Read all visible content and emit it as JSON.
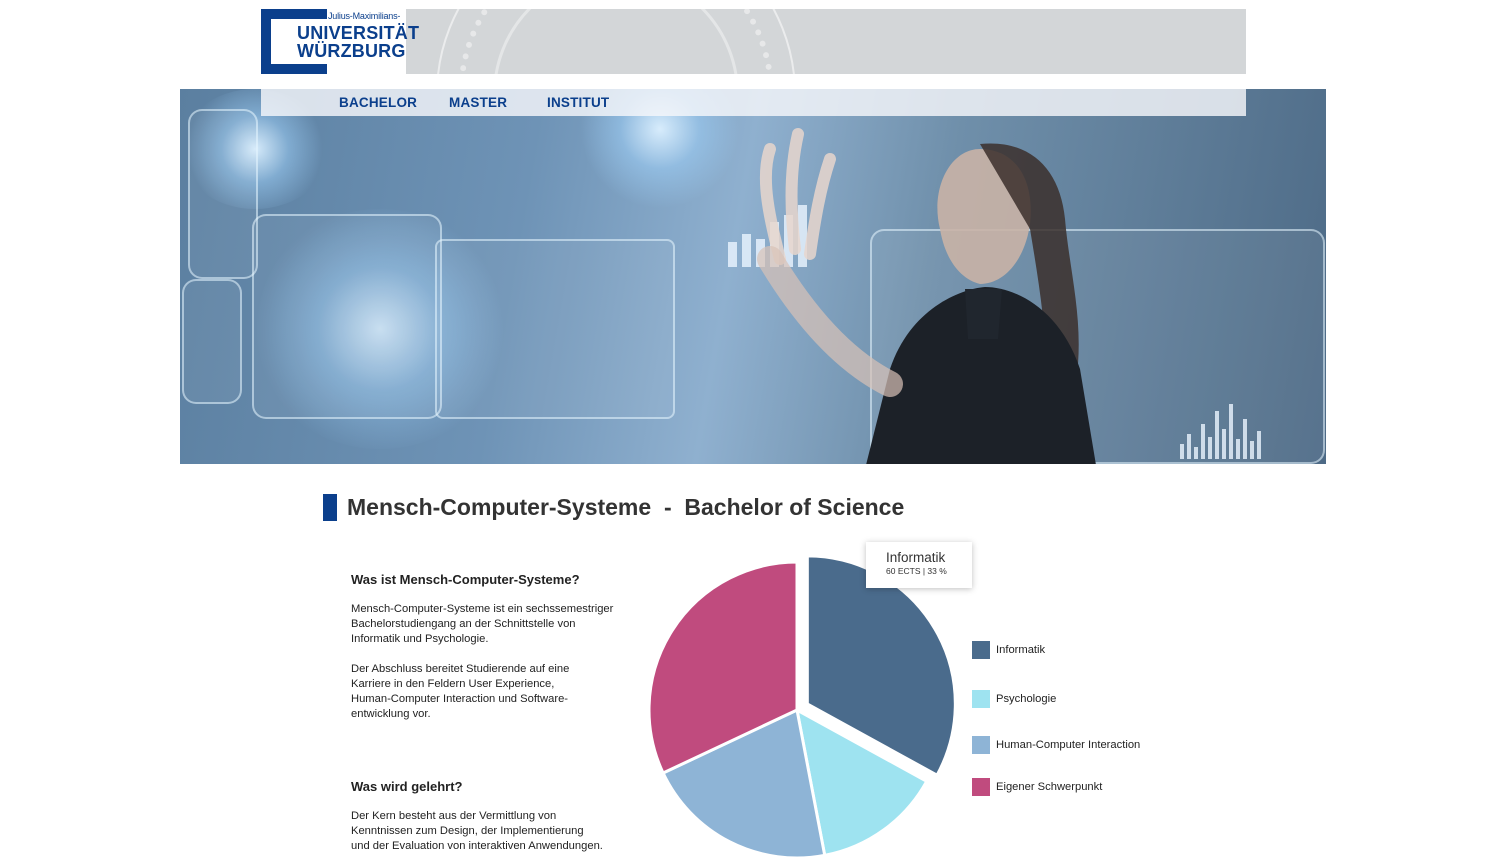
{
  "header": {
    "logo_small": "Julius-Maximilians-",
    "logo_line1": "UNIVERSITÄT",
    "logo_line2": "WÜRZBURG",
    "seal_left": "15",
    "seal_right": "83"
  },
  "nav": {
    "items": [
      {
        "label": "BACHELOR"
      },
      {
        "label": "MASTER"
      },
      {
        "label": "INSTITUT"
      }
    ]
  },
  "page": {
    "title": "Mensch-Computer-Systeme  -  Bachelor of Science"
  },
  "content": {
    "section1_heading": "Was ist Mensch-Computer-Systeme?",
    "section1_p1_lines": [
      "Mensch-Computer-Systeme ist ein sechssemestriger",
      "Bachelorstudiengang an der Schnittstelle von",
      "Informatik und Psychologie."
    ],
    "section1_p2_lines": [
      "Der Abschluss bereitet Studierende auf eine",
      "Karriere in den Feldern User Experience,",
      "Human-Computer Interaction und Software-",
      "entwicklung vor."
    ],
    "section2_heading": "Was wird gelehrt?",
    "section2_p1_lines": [
      "Der Kern besteht aus der Vermittlung von",
      "Kenntnissen zum Design, der Implementierung",
      "und der Evaluation von interaktiven Anwendungen."
    ]
  },
  "tooltip": {
    "title": "Informatik",
    "subtitle": "60 ECTS | 33 %"
  },
  "colors": {
    "brand": "#0b3f8c",
    "informatik": "#4a6b8c",
    "psychologie": "#9ee3f0",
    "hci": "#8eb4d6",
    "schwerpunkt": "#c04b7e"
  },
  "chart_data": {
    "type": "pie",
    "title": "",
    "categories": [
      "Informatik",
      "Psychologie",
      "Human-Computer Interaction",
      "Eigener Schwerpunkt"
    ],
    "values": [
      33,
      14,
      21,
      32
    ],
    "colors": [
      "#4a6b8c",
      "#9ee3f0",
      "#8eb4d6",
      "#c04b7e"
    ],
    "exploded": "Informatik",
    "legend_position": "right"
  }
}
